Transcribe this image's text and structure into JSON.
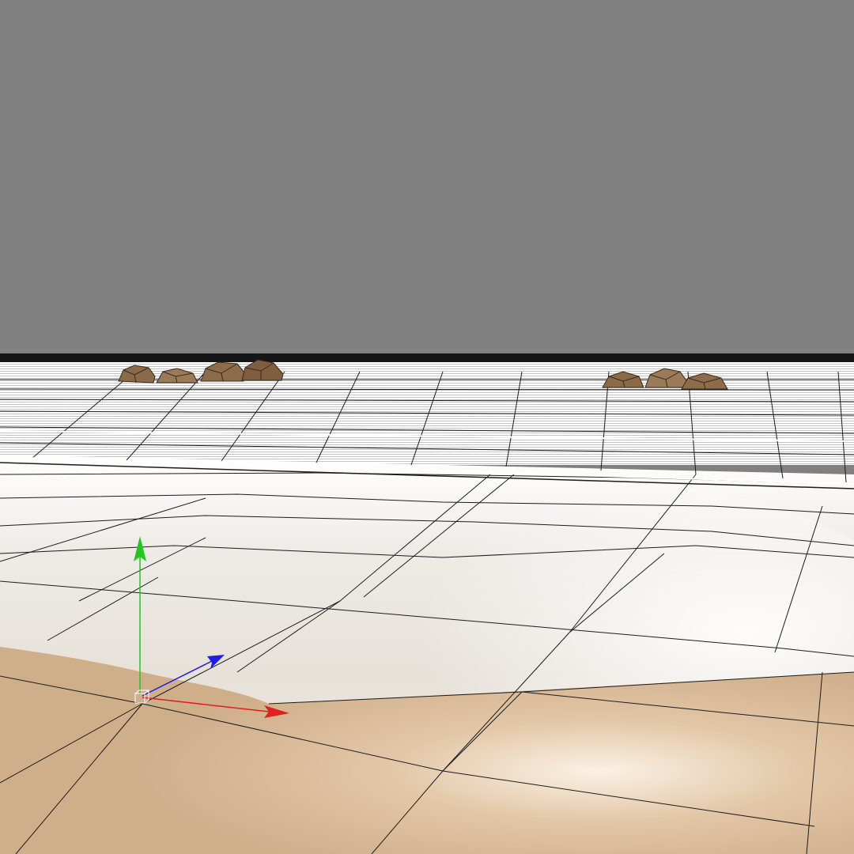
{
  "viewport": {
    "background": "#808080",
    "ground_color": "#f2efe9",
    "sand_color": "#d2b08c",
    "wireframe_color": "#1c1c1c",
    "rock_color": "#8a6a48"
  },
  "gizmo": {
    "x_axis_color": "#e0201c",
    "y_axis_color": "#1ec81e",
    "z_axis_color": "#1e1ee6",
    "icon": "transform-gizmo-icon"
  },
  "rocks": {
    "icon": "rock-icon"
  }
}
